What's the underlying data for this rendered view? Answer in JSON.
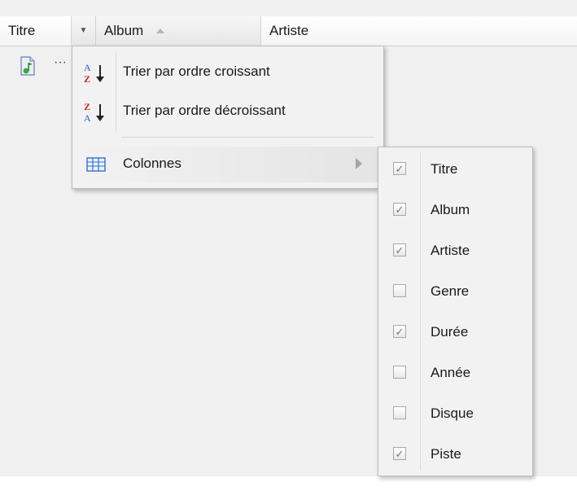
{
  "header": {
    "titre_label": "Titre",
    "album_label": "Album",
    "artiste_label": "Artiste",
    "album_sort": "ascending"
  },
  "row": {
    "icon": "music-file-icon",
    "ellipsis": "···"
  },
  "column_menu": {
    "items": [
      {
        "label": "Trier par ordre croissant",
        "icon": "sort-a-z-icon"
      },
      {
        "label": "Trier par ordre décroissant",
        "icon": "sort-z-a-icon"
      },
      {
        "label": "Colonnes",
        "icon": "columns-icon"
      }
    ]
  },
  "columns_submenu": {
    "items": [
      {
        "label": "Titre",
        "checked": true
      },
      {
        "label": "Album",
        "checked": true
      },
      {
        "label": "Artiste",
        "checked": true
      },
      {
        "label": "Genre",
        "checked": false
      },
      {
        "label": "Durée",
        "checked": true
      },
      {
        "label": "Année",
        "checked": false
      },
      {
        "label": "Disque",
        "checked": false
      },
      {
        "label": "Piste",
        "checked": true
      }
    ]
  },
  "colors": {
    "accent_blue": "#2f63c6",
    "accent_red": "#c62828",
    "check_gray": "#777777"
  }
}
